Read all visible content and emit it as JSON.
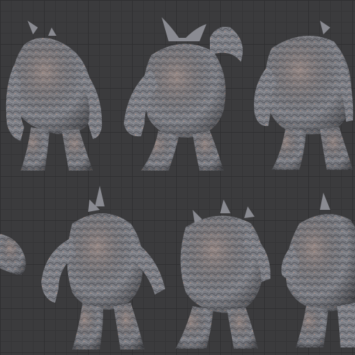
{
  "scene": {
    "background_color": "#3b3b3d",
    "grid_major_color": "#2f2f31",
    "grid_minor_color": "#353537",
    "model_base_color": "#7d7f86",
    "model_shadow_color": "#4a4b51",
    "model_highlight_color": "#c29a86"
  },
  "views": [
    {
      "name": "view-back-left",
      "icon": "creature-figure"
    },
    {
      "name": "view-back-hand-on-head",
      "icon": "creature-figure"
    },
    {
      "name": "view-back-right",
      "icon": "creature-figure"
    },
    {
      "name": "view-side-partial",
      "icon": "creature-figure"
    },
    {
      "name": "view-back-horn",
      "icon": "creature-figure"
    },
    {
      "name": "view-three-quarter-left",
      "icon": "creature-figure"
    },
    {
      "name": "view-side-right",
      "icon": "creature-figure"
    }
  ]
}
